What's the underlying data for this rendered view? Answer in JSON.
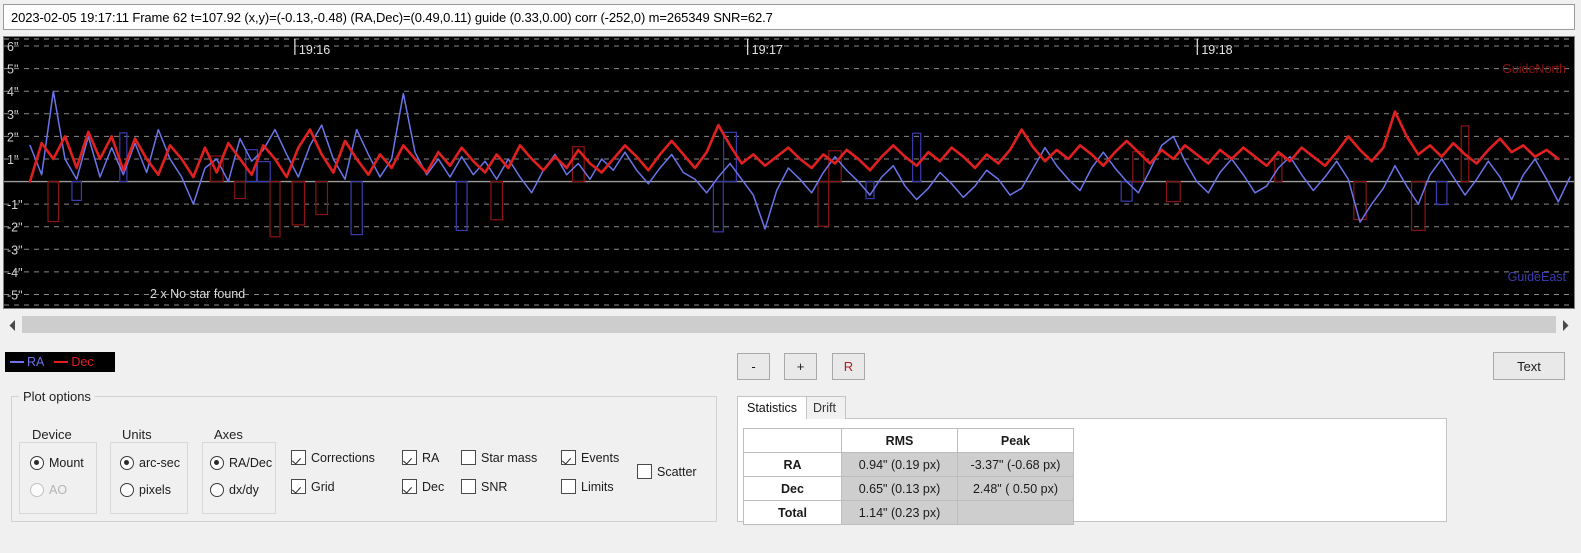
{
  "status": {
    "text": "2023-02-05 19:17:11 Frame 62 t=107.92 (x,y)=(-0.13,-0.48) (RA,Dec)=(0.49,0.11) guide (0.33,0.00) corr (-252,0) m=265349 SNR=62.7"
  },
  "chart_data": {
    "type": "line",
    "title": "",
    "xlabel": "",
    "ylabel": "arc-sec",
    "background": "#000000",
    "grid": true,
    "ylim": [
      -5.6,
      6.4
    ],
    "yticks": [
      "6\"",
      "5\"",
      "4\"",
      "3\"",
      "2\"",
      "1\"",
      "-1\"",
      "-2\"",
      "-3\"",
      "-4\"",
      "-5\""
    ],
    "ytick_values": [
      6,
      5,
      4,
      3,
      2,
      1,
      -1,
      -2,
      -3,
      -4,
      -5
    ],
    "xticks": [
      "19:16",
      "19:17",
      "19:18"
    ],
    "xtick_positions": [
      0.172,
      0.466,
      0.758
    ],
    "annotations": [
      {
        "text": "GuideNorth",
        "position": "top-right",
        "color": "#8c1414"
      },
      {
        "text": "GuideEast",
        "position": "bottom-right",
        "color": "#3b3bb0"
      },
      {
        "text": "2 x No star found",
        "position": "bottom-left",
        "color": "#d8d8d8"
      }
    ],
    "legend_position": "below-left",
    "series": [
      {
        "name": "RA",
        "color": "#6a74e8",
        "values": [
          1.6,
          0.3,
          4.0,
          1.0,
          0.1,
          2.0,
          0.2,
          1.5,
          0.3,
          1.7,
          0.4,
          2.3,
          1.0,
          0.2,
          -1.0,
          0.6,
          1.0,
          0.0,
          1.9,
          0.9,
          1.4,
          2.3,
          1.2,
          0.2,
          1.6,
          2.5,
          1.0,
          0.1,
          2.3,
          1.2,
          0.2,
          1.0,
          3.9,
          1.3,
          0.3,
          1.0,
          0.2,
          1.1,
          0.3,
          0.9,
          0.1,
          1.0,
          0.2,
          -0.5,
          0.5,
          1.2,
          0.3,
          0.8,
          0.1,
          1.0,
          0.5,
          1.3,
          0.5,
          -0.1,
          0.6,
          1.2,
          0.4,
          0.1,
          -0.5,
          0.2,
          0.8,
          0.1,
          -0.6,
          -2.1,
          -0.4,
          0.6,
          0.1,
          -0.5,
          0.4,
          1.1,
          0.5,
          0.0,
          -0.6,
          0.2,
          0.7,
          -0.2,
          -0.8,
          -0.3,
          0.4,
          -0.1,
          -0.7,
          -0.2,
          0.5,
          0.1,
          -0.6,
          -0.3,
          0.6,
          1.5,
          0.7,
          0.1,
          -0.4,
          0.6,
          1.3,
          0.6,
          0.0,
          -0.5,
          0.5,
          1.6,
          2.0,
          0.9,
          0.0,
          -0.5,
          0.4,
          1.0,
          0.3,
          -0.5,
          -0.2,
          0.6,
          1.1,
          0.3,
          -0.4,
          0.2,
          0.9,
          0.1,
          -1.8,
          -1.0,
          -0.3,
          0.7,
          -0.2,
          -1.0,
          0.3,
          1.0,
          0.2,
          -0.6,
          0.1,
          0.9,
          0.2,
          -0.8,
          0.3,
          1.0,
          0.1,
          -0.9,
          0.2
        ]
      },
      {
        "name": "Dec",
        "color": "#e02020",
        "values": [
          0.0,
          1.7,
          1.0,
          2.0,
          0.6,
          2.2,
          1.0,
          2.0,
          0.5,
          1.9,
          1.0,
          0.3,
          1.6,
          1.0,
          0.2,
          1.5,
          0.4,
          1.7,
          1.0,
          0.3,
          1.6,
          1.0,
          0.2,
          1.5,
          2.3,
          1.2,
          0.4,
          1.8,
          1.0,
          0.3,
          1.2,
          0.6,
          1.6,
          1.0,
          0.4,
          1.3,
          0.7,
          1.5,
          0.9,
          0.4,
          1.2,
          0.6,
          1.6,
          1.0,
          0.5,
          1.1,
          0.6,
          1.4,
          0.8,
          0.4,
          1.0,
          1.6,
          1.1,
          0.5,
          1.2,
          1.8,
          1.2,
          0.6,
          1.3,
          2.5,
          1.6,
          0.8,
          1.2,
          0.7,
          1.1,
          1.5,
          1.0,
          0.6,
          1.2,
          0.8,
          1.4,
          1.0,
          0.5,
          1.1,
          1.6,
          1.1,
          0.7,
          1.3,
          0.9,
          1.5,
          1.1,
          0.6,
          1.2,
          0.8,
          1.4,
          2.3,
          1.5,
          0.9,
          1.4,
          1.0,
          1.6,
          1.2,
          0.7,
          1.3,
          1.8,
          1.3,
          0.8,
          1.4,
          1.0,
          1.6,
          1.2,
          0.8,
          1.4,
          1.0,
          1.5,
          1.1,
          0.7,
          1.3,
          0.9,
          1.5,
          1.1,
          0.7,
          1.3,
          2.0,
          1.4,
          0.9,
          1.5,
          3.1,
          2.0,
          1.2,
          1.6,
          1.1,
          1.7,
          1.2,
          0.8,
          1.4,
          1.9,
          1.3,
          1.6,
          1.1,
          1.4,
          1.0
        ]
      }
    ],
    "corrections": {
      "ra_color": "#3b3bb0",
      "dec_color": "#8c1414",
      "note": "hollow rectangle pulses drawn near the zero line"
    }
  },
  "legend": {
    "ra_label": "RA",
    "dec_label": "Dec",
    "ra_color": "#6a74e8",
    "dec_color": "#e02020"
  },
  "scrollbar": {
    "left_arrow": "chevron-left-icon",
    "right_arrow": "chevron-right-icon"
  },
  "toolbar": {
    "zoom_out_label": "-",
    "zoom_in_label": "+",
    "reset_label": "R",
    "text_label": "Text"
  },
  "plot_options": {
    "title": "Plot options",
    "device": {
      "title": "Device",
      "options": [
        {
          "label": "Mount",
          "selected": true,
          "enabled": true
        },
        {
          "label": "AO",
          "selected": false,
          "enabled": false
        }
      ]
    },
    "units": {
      "title": "Units",
      "options": [
        {
          "label": "arc-sec",
          "selected": true,
          "enabled": true
        },
        {
          "label": "pixels",
          "selected": false,
          "enabled": true
        }
      ]
    },
    "axes": {
      "title": "Axes",
      "options": [
        {
          "label": "RA/Dec",
          "selected": true,
          "enabled": true
        },
        {
          "label": "dx/dy",
          "selected": false,
          "enabled": true
        }
      ]
    },
    "checkboxes": [
      {
        "label": "Corrections",
        "checked": true
      },
      {
        "label": "Grid",
        "checked": true
      },
      {
        "label": "RA",
        "checked": true
      },
      {
        "label": "Dec",
        "checked": true
      },
      {
        "label": "Star mass",
        "checked": false
      },
      {
        "label": "SNR",
        "checked": false
      },
      {
        "label": "Events",
        "checked": true
      },
      {
        "label": "Limits",
        "checked": false
      },
      {
        "label": "Scatter",
        "checked": false
      }
    ]
  },
  "stats": {
    "tabs": [
      {
        "label": "Statistics",
        "active": true
      },
      {
        "label": "Drift",
        "active": false
      }
    ],
    "columns": [
      "",
      "RMS",
      "Peak"
    ],
    "rows": [
      {
        "name": "RA",
        "rms": "0.94\" (0.19 px)",
        "peak": "-3.37\" (-0.68 px)"
      },
      {
        "name": "Dec",
        "rms": "0.65\" (0.13 px)",
        "peak": "2.48\" ( 0.50 px)"
      },
      {
        "name": "Total",
        "rms": "1.14\" (0.23 px)",
        "peak": ""
      }
    ]
  }
}
